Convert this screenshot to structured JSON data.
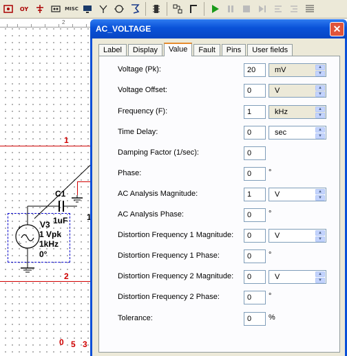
{
  "toolbar": {
    "buttons": [
      "DRC-icon",
      "OY-icon",
      "power-icon",
      "MISC",
      "monitor-icon",
      "antenna-icon",
      "meter-icon",
      "probe-icon",
      "chip-icon",
      "junction-icon",
      "bus-icon",
      "play-icon",
      "pause-icon",
      "stop-icon",
      "step-icon",
      "step-in-icon",
      "step-out-icon",
      "grid-icon"
    ],
    "misc_label": "MISC",
    "oy_label": "OY"
  },
  "ruler": {
    "mark": "2"
  },
  "schematic": {
    "net_1": "1",
    "net_2": "2",
    "net_0": "0",
    "net_5": "5",
    "net_3": "3",
    "net_1b": "1",
    "cap_ref": "C1",
    "cap_value": "1uF",
    "src_ref": "V3",
    "src_amp": "1 Vpk",
    "src_freq": "1kHz",
    "src_phase": "0°"
  },
  "dialog": {
    "title": "AC_VOLTAGE",
    "close": "✕",
    "tabs": [
      "Label",
      "Display",
      "Value",
      "Fault",
      "Pins",
      "User fields"
    ],
    "active_tab": "Value",
    "rows": [
      {
        "label": "Voltage (Pk):",
        "value": "20",
        "unit": "mV",
        "unit_disabled": true
      },
      {
        "label": "Voltage Offset:",
        "value": "0",
        "unit": "V",
        "unit_disabled": true
      },
      {
        "label": "Frequency (F):",
        "value": "1",
        "unit": "kHz",
        "unit_disabled": true
      },
      {
        "label": "Time Delay:",
        "value": "0",
        "unit": "sec",
        "unit_disabled": false
      },
      {
        "label": "Damping Factor (1/sec):",
        "value": "0"
      },
      {
        "label": "Phase:",
        "value": "0",
        "symbol": "°"
      },
      {
        "label": "AC Analysis Magnitude:",
        "value": "1",
        "unit": "V",
        "unit_disabled": false
      },
      {
        "label": "AC Analysis Phase:",
        "value": "0",
        "symbol": "°"
      },
      {
        "label": "Distortion Frequency 1 Magnitude:",
        "value": "0",
        "unit": "V",
        "unit_disabled": false
      },
      {
        "label": "Distortion Frequency 1 Phase:",
        "value": "0",
        "symbol": "°"
      },
      {
        "label": "Distortion Frequency 2 Magnitude:",
        "value": "0",
        "unit": "V",
        "unit_disabled": false
      },
      {
        "label": "Distortion Frequency 2 Phase:",
        "value": "0",
        "symbol": "°"
      },
      {
        "label": "Tolerance:",
        "value": "0",
        "symbol": "%"
      }
    ]
  },
  "colors": {
    "title_blue": "#0a52d8",
    "net_red": "#d00000",
    "dialog_face": "#ece9d8",
    "active_tab_accent": "#e68b2c"
  }
}
